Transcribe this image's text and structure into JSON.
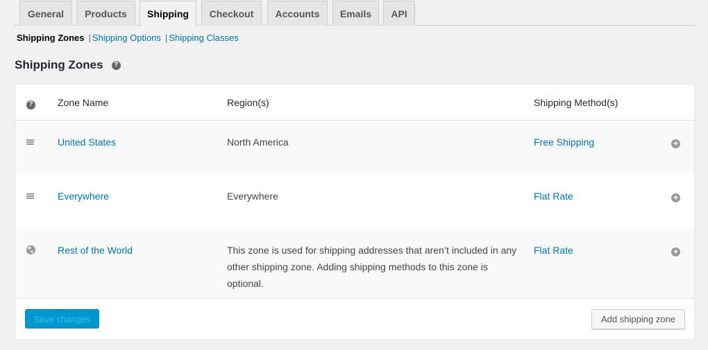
{
  "tabs": [
    {
      "label": "General",
      "active": false
    },
    {
      "label": "Products",
      "active": false
    },
    {
      "label": "Shipping",
      "active": true
    },
    {
      "label": "Checkout",
      "active": false
    },
    {
      "label": "Accounts",
      "active": false
    },
    {
      "label": "Emails",
      "active": false
    },
    {
      "label": "API",
      "active": false
    }
  ],
  "subnav": {
    "current": "Shipping Zones",
    "separator": "|",
    "links": [
      "Shipping Options",
      "Shipping Classes"
    ]
  },
  "heading": {
    "title": "Shipping Zones",
    "help_icon": "question-circle-icon",
    "help_glyph": "?"
  },
  "table": {
    "columns": [
      "",
      "Zone Name",
      "Region(s)",
      "Shipping Method(s)"
    ],
    "header_help_glyph": "?",
    "add_glyph": "+",
    "rows": [
      {
        "icon": "drag-handle-icon",
        "name": "United States",
        "region": "North America",
        "method": "Free Shipping"
      },
      {
        "icon": "drag-handle-icon",
        "name": "Everywhere",
        "region": "Everywhere",
        "method": "Flat Rate"
      },
      {
        "icon": "globe-icon",
        "name": "Rest of the World",
        "region": "This zone is used for shipping addresses that aren’t included in any other shipping zone. Adding shipping methods to this zone is optional.",
        "method": "Flat Rate"
      }
    ]
  },
  "footer": {
    "save_label": "Save changes",
    "save_disabled": true,
    "add_zone_label": "Add shipping zone"
  },
  "colors": {
    "link": "#0073aa",
    "primary_button": "#0097ce",
    "page_background": "#f1f1f1"
  }
}
